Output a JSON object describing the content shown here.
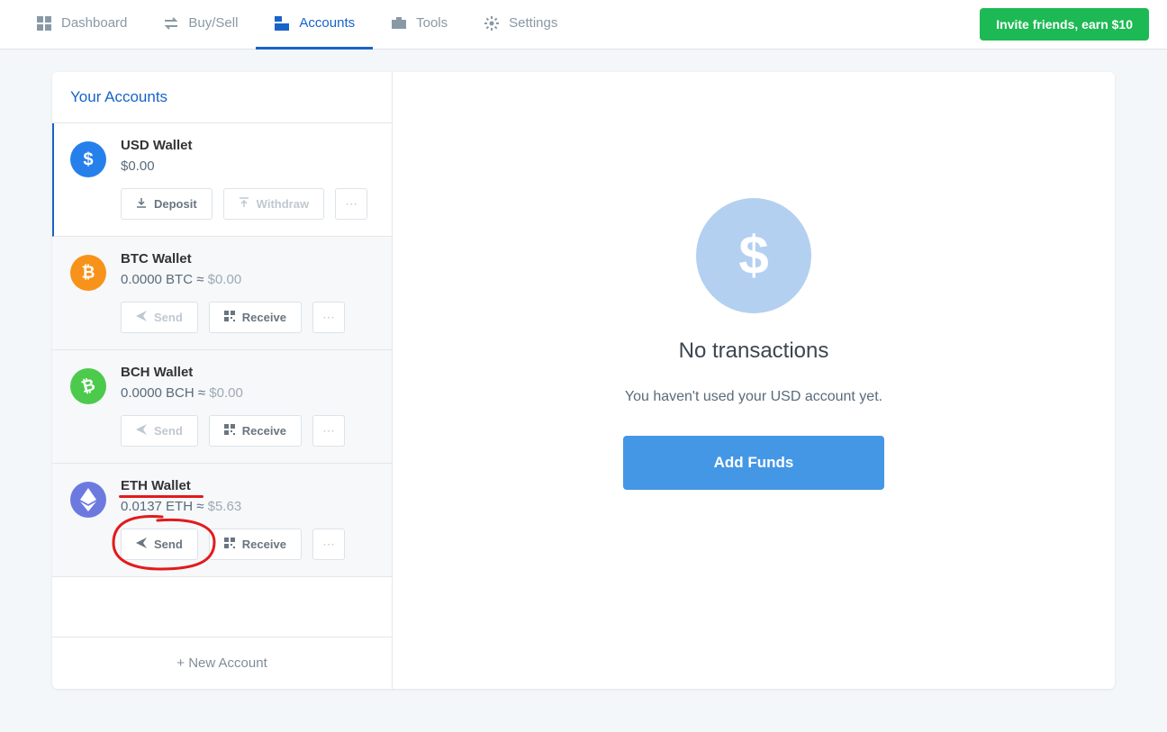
{
  "nav": {
    "items": [
      {
        "label": "Dashboard"
      },
      {
        "label": "Buy/Sell"
      },
      {
        "label": "Accounts"
      },
      {
        "label": "Tools"
      },
      {
        "label": "Settings"
      }
    ],
    "invite_label": "Invite friends, earn $10"
  },
  "accounts_panel": {
    "title": "Your Accounts",
    "new_account_label": "New Account"
  },
  "accounts": [
    {
      "name": "USD Wallet",
      "balance": "$0.00",
      "actions": {
        "a": "Deposit",
        "b": "Withdraw"
      }
    },
    {
      "name": "BTC Wallet",
      "balance_crypto": "0.0000 BTC",
      "balance_usd": "$0.00",
      "actions": {
        "a": "Send",
        "b": "Receive"
      }
    },
    {
      "name": "BCH Wallet",
      "balance_crypto": "0.0000 BCH",
      "balance_usd": "$0.00",
      "actions": {
        "a": "Send",
        "b": "Receive"
      }
    },
    {
      "name": "ETH Wallet",
      "balance_crypto": "0.0137 ETH",
      "balance_usd": "$5.63",
      "actions": {
        "a": "Send",
        "b": "Receive"
      }
    }
  ],
  "details": {
    "title": "No transactions",
    "subtitle": "You haven't used your USD account yet.",
    "cta": "Add Funds"
  }
}
